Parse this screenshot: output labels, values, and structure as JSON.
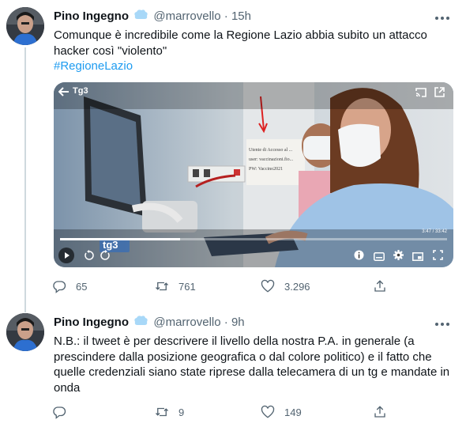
{
  "tweets": [
    {
      "author": "Pino Ingegno",
      "handle": "@marrovello",
      "separator": "·",
      "time": "15h",
      "text_line1": "Comunque è incredibile come la Regione Lazio abbia subito un attacco",
      "text_line2": "hacker così \"violento\"",
      "hashtag": "#RegioneLazio",
      "video": {
        "channel": "Tg3",
        "logo": "tg3",
        "note_lines": [
          "Utente di Accesso al ...",
          "user: vaccinazioni.fio...",
          "PW: Vaccino2021"
        ],
        "progress": 0.31,
        "elapsed_total": "3:47 / 33:42"
      },
      "stats": {
        "replies": "65",
        "retweets": "761",
        "likes": "3.296"
      }
    },
    {
      "author": "Pino Ingegno",
      "handle": "@marrovello",
      "separator": "·",
      "time": "9h",
      "lines": [
        "N.B.: il tweet è per descrivere il livello della nostra P.A. in generale (a",
        "prescindere dalla posizione geografica o dal colore politico) e il fatto che",
        "quelle credenziali siano state riprese dalla telecamera di un tg e mandate in",
        "onda"
      ],
      "stats": {
        "replies": "",
        "retweets": "9",
        "likes": "149"
      }
    }
  ],
  "icons": {
    "more": "more-horizontal-icon",
    "verified": "verified-badge-icon",
    "reply": "reply-icon",
    "retweet": "retweet-icon",
    "like": "heart-icon",
    "share": "share-icon"
  },
  "colors": {
    "link": "#1d9bf0",
    "muted": "#536471",
    "verified": "#8ecdf8"
  }
}
